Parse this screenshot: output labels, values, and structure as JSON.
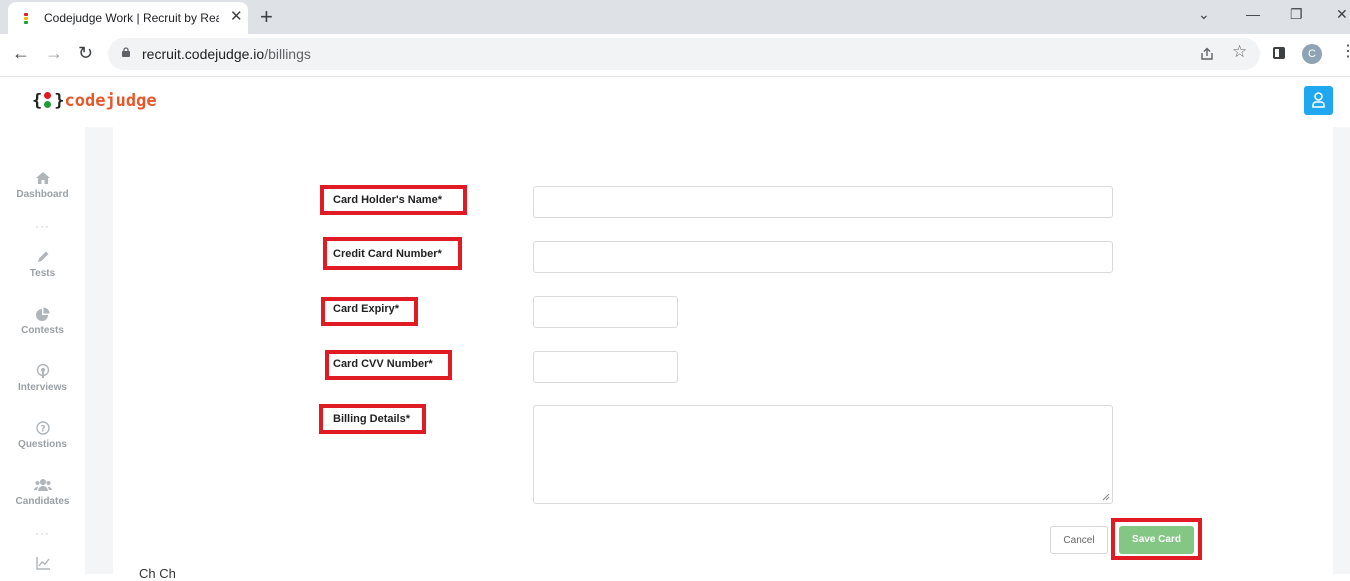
{
  "browser": {
    "tab_title": "Codejudge Work | Recruit by Rea",
    "tab_close": "✕",
    "new_tab": "+",
    "url_host": "recruit.codejudge.io",
    "url_path": "/billings",
    "profile_initial": "C",
    "window_controls": {
      "minimize": "—",
      "maximize": "❐",
      "close": "✕",
      "tab_list": "⌄"
    },
    "nav": {
      "back": "←",
      "forward": "→",
      "reload": "↻"
    },
    "icons": {
      "share": "share-icon",
      "star": "☆",
      "menu": "⋮"
    }
  },
  "brand": {
    "open_brace": "{",
    "close_brace": "}",
    "name": "codejudge",
    "colors": {
      "accent": "#e8572a",
      "dot_red": "#e01b24",
      "dot_green": "#1e9e3a"
    }
  },
  "sidebar": {
    "items": [
      {
        "label": "Dashboard",
        "icon": "home-icon"
      },
      {
        "label": "Tests",
        "icon": "pencil-icon"
      },
      {
        "label": "Contests",
        "icon": "pie-chart-icon"
      },
      {
        "label": "Interviews",
        "icon": "podcast-icon"
      },
      {
        "label": "Questions",
        "icon": "question-circle-icon"
      },
      {
        "label": "Candidates",
        "icon": "users-icon"
      },
      {
        "label": "",
        "icon": "line-chart-icon"
      }
    ],
    "separator": "···"
  },
  "form": {
    "card_holder_label": "Card Holder's Name*",
    "card_number_label": "Credit Card Number*",
    "expiry_label": "Card Expiry*",
    "cvv_label": "Card CVV Number*",
    "billing_label": "Billing Details*",
    "card_holder_value": "",
    "card_number_value": "",
    "expiry_value": "",
    "cvv_value": "",
    "billing_value": ""
  },
  "actions": {
    "cancel": "Cancel",
    "save": "Save Card",
    "save_color": "#84c784",
    "highlight_color": "#e01b24"
  },
  "footer": {
    "cut_text": "Ch   Ch"
  }
}
